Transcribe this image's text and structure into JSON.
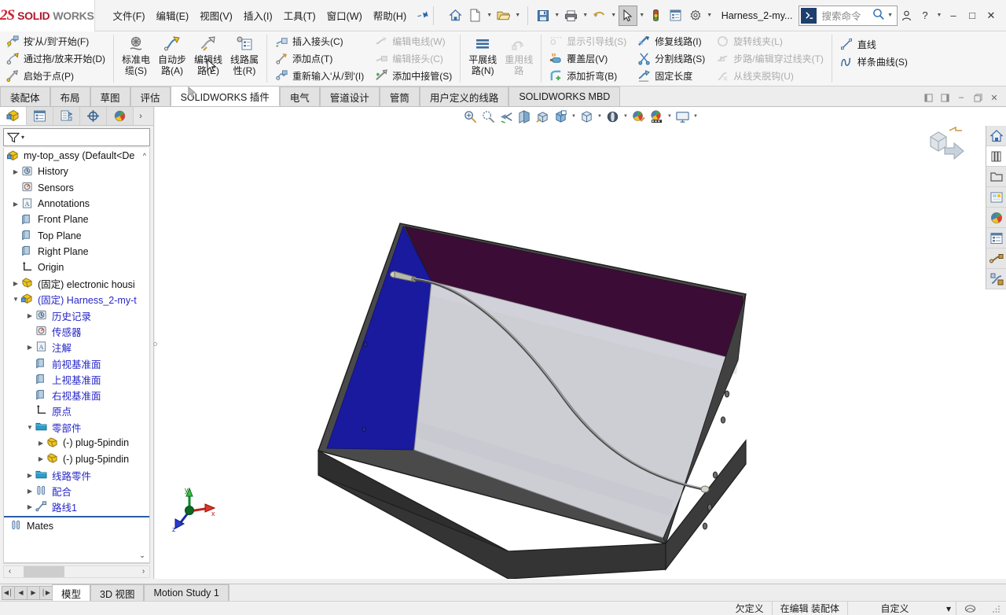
{
  "app": {
    "brand_ds": "2S",
    "brand_solid": "SOLID",
    "brand_works": "WORKS",
    "document_title": "Harness_2-my...",
    "accent_blue": "#2a68b0",
    "brand_red": "#cf2030"
  },
  "menus": [
    {
      "label": "文件(F)",
      "name": "menu-file"
    },
    {
      "label": "编辑(E)",
      "name": "menu-edit"
    },
    {
      "label": "视图(V)",
      "name": "menu-view"
    },
    {
      "label": "插入(I)",
      "name": "menu-insert"
    },
    {
      "label": "工具(T)",
      "name": "menu-tools"
    },
    {
      "label": "窗口(W)",
      "name": "menu-window"
    },
    {
      "label": "帮助(H)",
      "name": "menu-help"
    }
  ],
  "quick_access": [
    {
      "name": "home-icon",
      "caret": false
    },
    {
      "name": "new-document-icon",
      "caret": true
    },
    {
      "name": "open-document-icon",
      "caret": true
    },
    {
      "name": "save-icon",
      "caret": true
    },
    {
      "name": "print-icon",
      "caret": true
    },
    {
      "name": "undo-icon",
      "caret": true
    },
    {
      "name": "select-pointer-icon",
      "caret": true
    },
    {
      "name": "rebuild-traffic-light-icon",
      "caret": false
    },
    {
      "name": "file-properties-icon",
      "caret": false
    },
    {
      "name": "options-gear-icon",
      "caret": true
    }
  ],
  "search": {
    "placeholder": "搜索命令",
    "badge": "➜"
  },
  "window_controls": {
    "account": "account-icon",
    "help": "?",
    "minimize": "–",
    "maximize": "□",
    "close": "✕"
  },
  "ribbon": {
    "groups": [
      {
        "name": "route-start-group",
        "type": "list",
        "items": [
          {
            "label": "按'从/到'开始(F)",
            "icon": "start-from-to-icon",
            "disabled": false
          },
          {
            "label": "通过拖/放来开始(D)",
            "icon": "start-drag-drop-icon",
            "disabled": false
          },
          {
            "label": "启始于点(P)",
            "icon": "start-at-point-icon",
            "disabled": false
          }
        ]
      },
      {
        "name": "cable-group",
        "type": "big",
        "items": [
          {
            "label": "标准电缆(S)",
            "icon": "standard-cable-icon",
            "disabled": false
          },
          {
            "label": "自动步路(A)",
            "icon": "auto-route-icon",
            "disabled": false
          },
          {
            "label": "编辑线路(E)",
            "icon": "edit-route-icon",
            "disabled": false
          },
          {
            "label": "线路属性(R)",
            "icon": "route-properties-icon",
            "disabled": false
          }
        ]
      },
      {
        "name": "connector-group",
        "type": "list2",
        "col1": [
          {
            "label": "插入接头(C)",
            "icon": "insert-connector-icon",
            "disabled": false
          },
          {
            "label": "添加点(T)",
            "icon": "add-point-icon",
            "disabled": false
          },
          {
            "label": "重新输入'从/到'(I)",
            "icon": "reimport-from-to-icon",
            "disabled": false
          }
        ],
        "col2": [
          {
            "label": "编辑电线(W)",
            "icon": "edit-wire-icon",
            "disabled": true
          },
          {
            "label": "编辑接头(C)",
            "icon": "edit-connector-icon",
            "disabled": true
          },
          {
            "label": "添加中接管(S)",
            "icon": "add-splice-icon",
            "disabled": false
          }
        ]
      },
      {
        "name": "flatten-group",
        "type": "big",
        "items": [
          {
            "label": "平展线路(N)",
            "icon": "flatten-route-icon",
            "disabled": false
          },
          {
            "label": "重用线路",
            "icon": "reuse-route-icon",
            "disabled": true
          }
        ]
      },
      {
        "name": "route-tools-group",
        "type": "list3",
        "col1": [
          {
            "label": "显示引导线(S)",
            "icon": "show-guide-line-icon",
            "disabled": true
          },
          {
            "label": "覆盖层(V)",
            "icon": "covering-icon",
            "disabled": false
          },
          {
            "label": "添加折弯(B)",
            "icon": "add-bend-icon",
            "disabled": false
          }
        ],
        "col2": [
          {
            "label": "修复线路(I)",
            "icon": "repair-route-icon",
            "disabled": false
          },
          {
            "label": "分割线路(S)",
            "icon": "split-route-icon",
            "disabled": false
          },
          {
            "label": "固定长度",
            "icon": "fixed-length-icon",
            "disabled": false
          }
        ],
        "col3": [
          {
            "label": "旋转线夹(L)",
            "icon": "rotate-clip-icon",
            "disabled": true
          },
          {
            "label": "步路/编辑穿过线夹(T)",
            "icon": "route-through-clip-icon",
            "disabled": true
          },
          {
            "label": "从线夹脱钩(U)",
            "icon": "unhook-from-clip-icon",
            "disabled": true
          }
        ]
      },
      {
        "name": "sketch-group",
        "type": "list",
        "items": [
          {
            "label": "直线",
            "icon": "line-icon",
            "disabled": false
          },
          {
            "label": "样条曲线(S)",
            "icon": "spline-icon",
            "disabled": false
          }
        ]
      }
    ]
  },
  "command_tabs": [
    {
      "label": "装配体",
      "active": false,
      "name": "tab-assembly"
    },
    {
      "label": "布局",
      "active": false,
      "name": "tab-layout"
    },
    {
      "label": "草图",
      "active": false,
      "name": "tab-sketch"
    },
    {
      "label": "评估",
      "active": false,
      "name": "tab-evaluate"
    },
    {
      "label": "SOLIDWORKS 插件",
      "active": true,
      "name": "tab-solidworks-addins"
    },
    {
      "label": "电气",
      "active": false,
      "name": "tab-electrical"
    },
    {
      "label": "管道设计",
      "active": false,
      "name": "tab-piping"
    },
    {
      "label": "管筒",
      "active": false,
      "name": "tab-tubing"
    },
    {
      "label": "用户定义的线路",
      "active": false,
      "name": "tab-custom-route"
    },
    {
      "label": "SOLIDWORKS MBD",
      "active": false,
      "name": "tab-solidworks-mbd"
    }
  ],
  "mdi_controls": {
    "restore_left": "restore-left-icon",
    "restore_right": "restore-right-icon",
    "minimize": "–",
    "maximize": "maximize-icon",
    "close": "✕"
  },
  "left_panel": {
    "tabs": [
      {
        "name": "feature-manager-tab",
        "icon": "feature-tree-icon",
        "active": true
      },
      {
        "name": "property-manager-tab",
        "icon": "property-list-icon",
        "active": false
      },
      {
        "name": "configuration-manager-tab",
        "icon": "configuration-icon",
        "active": false
      },
      {
        "name": "dimxpert-manager-tab",
        "icon": "dimxpert-icon",
        "active": false
      },
      {
        "name": "display-manager-tab",
        "icon": "display-sphere-icon",
        "active": false
      }
    ],
    "filter_placeholder": "",
    "tree": [
      {
        "label": "my-top_assy  (Default<De",
        "depth": 0,
        "twist": "",
        "icon": "assembly-icon",
        "color": "black",
        "name": "tree-root-assembly"
      },
      {
        "label": "History",
        "depth": 1,
        "twist": "right",
        "icon": "history-icon",
        "color": "black",
        "name": "tree-item-history"
      },
      {
        "label": "Sensors",
        "depth": 1,
        "twist": "",
        "icon": "sensors-icon",
        "color": "black",
        "name": "tree-item-sensors"
      },
      {
        "label": "Annotations",
        "depth": 1,
        "twist": "right",
        "icon": "annotations-icon",
        "color": "black",
        "name": "tree-item-annotations"
      },
      {
        "label": "Front Plane",
        "depth": 1,
        "twist": "",
        "icon": "plane-icon",
        "color": "black",
        "name": "tree-item-front-plane"
      },
      {
        "label": "Top Plane",
        "depth": 1,
        "twist": "",
        "icon": "plane-icon",
        "color": "black",
        "name": "tree-item-top-plane"
      },
      {
        "label": "Right Plane",
        "depth": 1,
        "twist": "",
        "icon": "plane-icon",
        "color": "black",
        "name": "tree-item-right-plane"
      },
      {
        "label": "Origin",
        "depth": 1,
        "twist": "",
        "icon": "origin-icon",
        "color": "black",
        "name": "tree-item-origin"
      },
      {
        "label": "(固定) electronic housi",
        "depth": 0,
        "twist": "right",
        "icon": "part-icon",
        "color": "black",
        "name": "tree-item-electronic-housing"
      },
      {
        "label": "(固定) Harness_2-my-t",
        "depth": 0,
        "twist": "down",
        "icon": "subassembly-icon",
        "color": "blue",
        "name": "tree-item-harness-2"
      },
      {
        "label": "历史记录",
        "depth": 1,
        "twist": "right",
        "icon": "history-icon",
        "color": "blue",
        "name": "tree-item-history-cn"
      },
      {
        "label": "传感器",
        "depth": 1,
        "twist": "",
        "icon": "sensors-icon",
        "color": "blue",
        "name": "tree-item-sensors-cn"
      },
      {
        "label": "注解",
        "depth": 1,
        "twist": "right",
        "icon": "annotations-icon",
        "color": "blue",
        "name": "tree-item-annotations-cn"
      },
      {
        "label": "前视基准面",
        "depth": 2,
        "twist": "",
        "icon": "plane-icon",
        "color": "blue",
        "name": "tree-item-front-plane-cn"
      },
      {
        "label": "上视基准面",
        "depth": 2,
        "twist": "",
        "icon": "plane-icon",
        "color": "blue",
        "name": "tree-item-top-plane-cn"
      },
      {
        "label": "右视基准面",
        "depth": 2,
        "twist": "",
        "icon": "plane-icon",
        "color": "blue",
        "name": "tree-item-right-plane-cn"
      },
      {
        "label": "原点",
        "depth": 2,
        "twist": "",
        "icon": "origin-icon",
        "color": "blue",
        "name": "tree-item-origin-cn"
      },
      {
        "label": "零部件",
        "depth": 1,
        "twist": "down",
        "icon": "folder-icon",
        "color": "blue",
        "name": "tree-item-components"
      },
      {
        "label": "(-) plug-5pindin",
        "depth": 2,
        "twist": "right",
        "icon": "part-icon",
        "color": "black",
        "name": "tree-item-plug-5pindin-1"
      },
      {
        "label": "(-) plug-5pindin",
        "depth": 2,
        "twist": "right",
        "icon": "part-icon",
        "color": "black",
        "name": "tree-item-plug-5pindin-2"
      },
      {
        "label": "线路零件",
        "depth": 1,
        "twist": "right",
        "icon": "folder-icon",
        "color": "blue",
        "name": "tree-item-route-parts"
      },
      {
        "label": "配合",
        "depth": 1,
        "twist": "right",
        "icon": "mates-icon",
        "color": "blue",
        "name": "tree-item-mates-cn"
      },
      {
        "label": "路线1",
        "depth": 1,
        "twist": "right",
        "icon": "route-icon",
        "color": "blue",
        "name": "tree-item-route-1"
      },
      {
        "label": "Mates",
        "depth": 0,
        "twist": "",
        "icon": "mates-icon",
        "color": "black",
        "name": "tree-item-mates"
      }
    ]
  },
  "view_toolbar": [
    {
      "name": "zoom-to-fit-icon",
      "caret": false
    },
    {
      "name": "zoom-to-area-icon",
      "caret": false
    },
    {
      "name": "previous-view-icon",
      "caret": false
    },
    {
      "name": "section-view-icon",
      "caret": false
    },
    {
      "name": "view-orientation-icon",
      "caret": false
    },
    {
      "name": "display-style-icon",
      "caret": true
    },
    {
      "name": "hide-show-items-icon",
      "caret": true
    },
    {
      "name": "edit-appearance-icon",
      "caret": true
    },
    {
      "name": "apply-scene-icon",
      "caret": false
    },
    {
      "name": "view-settings-icon",
      "caret": true
    },
    {
      "name": "viewport-layout-icon",
      "caret": true
    }
  ],
  "triad": {
    "x_label": "x",
    "y_label": "y",
    "z_label": "z"
  },
  "task_pane": [
    {
      "name": "sw-resources-icon",
      "active": false
    },
    {
      "name": "design-library-icon",
      "active": true
    },
    {
      "name": "file-explorer-icon",
      "active": false
    },
    {
      "name": "view-palette-icon",
      "active": false
    },
    {
      "name": "appearances-scenes-icon",
      "active": false
    },
    {
      "name": "custom-properties-icon",
      "active": false
    },
    {
      "name": "electrical-components-icon",
      "active": false
    },
    {
      "name": "routing-library-icon",
      "active": false
    }
  ],
  "bottom_tabs": [
    {
      "label": "模型",
      "active": true,
      "name": "bottom-tab-model"
    },
    {
      "label": "3D 视图",
      "active": false,
      "name": "bottom-tab-3d-views"
    },
    {
      "label": "Motion Study 1",
      "active": false,
      "name": "bottom-tab-motion-study-1"
    }
  ],
  "nav_buttons": [
    {
      "glyph": "◀│",
      "name": "nav-first"
    },
    {
      "glyph": "◀",
      "name": "nav-prev"
    },
    {
      "glyph": "▶",
      "name": "nav-next"
    },
    {
      "glyph": "│▶",
      "name": "nav-last"
    }
  ],
  "status_bar": {
    "underdefined": "欠定义",
    "editing": "在编辑 装配体",
    "units": "自定义",
    "units_caret": "▾"
  },
  "model": {
    "enclosure_top_color": "#cdcdd4",
    "enclosure_side_color": "#3a3a3a",
    "enclosure_inner_color": "#3b0d36",
    "enclosure_blue_color": "#1a1a9e",
    "cable_color": "#555555",
    "connector_color": "#b8b8b0"
  }
}
